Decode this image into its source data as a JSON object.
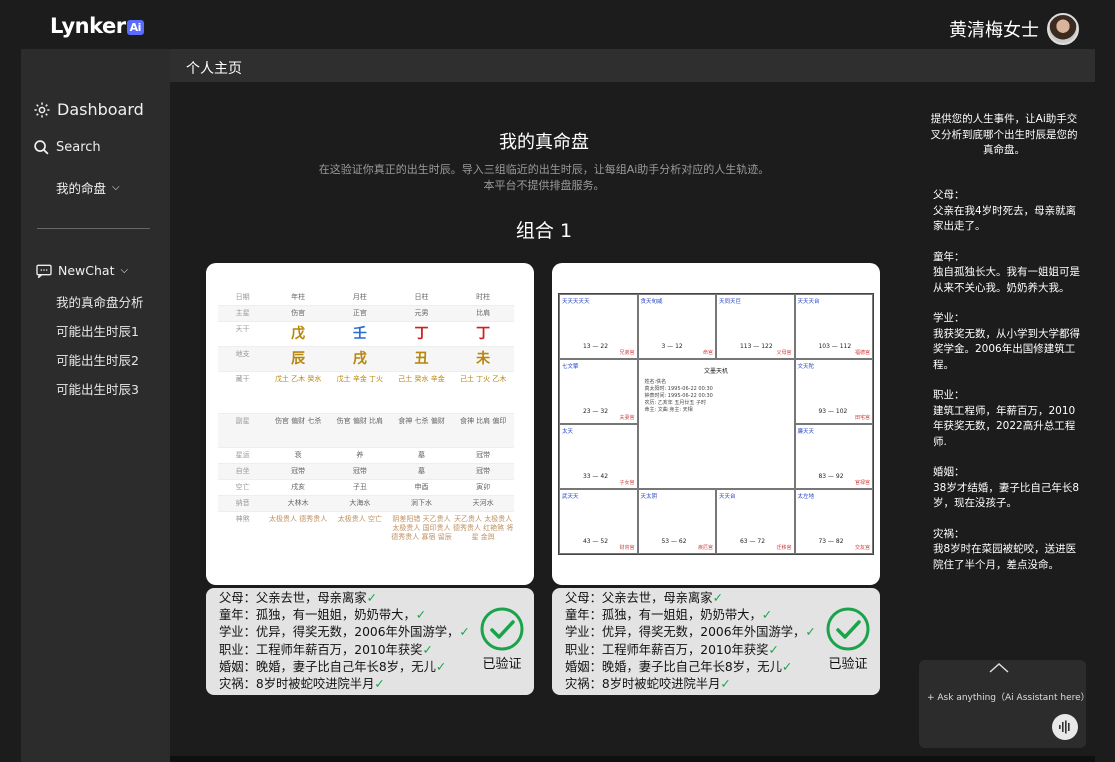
{
  "app": {
    "logo_text": "Lynker",
    "logo_badge": "Ai",
    "user_name": "黄清梅女士"
  },
  "header": {
    "page_label": "个人主页"
  },
  "sidebar": {
    "dashboard": "Dashboard",
    "search": "Search",
    "my_chart": "我的命盘",
    "newchat": "NewChat",
    "items": [
      "我的真命盘分析",
      "可能出生时辰1",
      "可能出生时辰2",
      "可能出生时辰3"
    ]
  },
  "main": {
    "title": "我的真命盘",
    "subtitle_1": "在这验证你真正的出生时辰。导入三组临近的出生时辰，让每组Ai助手分析对应的人生轨迹。",
    "subtitle_2": "本平台不提供排盘服务。",
    "group_title": "组合 1",
    "verified_label": "已验证",
    "info_lines": [
      "父母：父亲去世，母亲离家",
      "童年：孤独，有一姐姐，奶奶带大，",
      "学业：优异，得奖无数，2006年外国游学，",
      "职业：工程师年薪百万，2010年获奖",
      "婚姻：晚婚，妻子比自己年长8岁，无儿",
      "灾祸：8岁时被蛇咬进院半月"
    ]
  },
  "bazi": {
    "headers": [
      "日期",
      "年柱",
      "月柱",
      "日柱",
      "时柱"
    ],
    "zhuxing": [
      "主星",
      "伤官",
      "正官",
      "元男",
      "比肩"
    ],
    "tiangan": [
      "天干",
      "戊",
      "壬",
      "丁",
      "丁"
    ],
    "dizhi": [
      "地支",
      "辰",
      "戌",
      "丑",
      "未"
    ],
    "canggan": [
      "藏干",
      "戊土 乙木 癸水",
      "戊土 辛金 丁火",
      "己土 癸水 辛金",
      "己土 丁火 乙木"
    ],
    "fuxing": [
      "副星",
      "伤官 偏财 七杀",
      "伤官 偏财 比肩",
      "食神 七杀 偏财",
      "食神 比肩 偏印"
    ],
    "xingyun": [
      "星运",
      "衰",
      "养",
      "墓",
      "冠带"
    ],
    "zizuo": [
      "自坐",
      "冠带",
      "冠带",
      "墓",
      "冠带"
    ],
    "kongwang": [
      "空亡",
      "戌亥",
      "子丑",
      "申酉",
      "寅卯"
    ],
    "nayin": [
      "纳音",
      "大林木",
      "大海水",
      "涧下水",
      "天河水"
    ],
    "shensha": [
      "神煞",
      "太极贵人 德秀贵人",
      "太极贵人 空亡",
      "阴差阳错 天乙贵人 太极贵人 国印贵人 德秀贵人 寡宿 留辰",
      "天乙贵人 太极贵人 德秀贵人 红艳煞 将星 金舆"
    ]
  },
  "ziwei": {
    "center_title": "文墨天机",
    "cells": [
      {
        "stars": "天天天天天",
        "num": "13 — 22",
        "tag": "兄弟宫"
      },
      {
        "stars": "贪天旬咸",
        "num": "3 — 12",
        "tag": "命宫"
      },
      {
        "stars": "天同天巨",
        "num": "113 — 122",
        "tag": "父母宫"
      },
      {
        "stars": "天天天台",
        "num": "103 — 112",
        "tag": "福德宫"
      },
      {
        "stars": "七文擎",
        "num": "23 — 32",
        "tag": "夫妻宫"
      },
      {
        "stars": "文天陀",
        "num": "93 — 102",
        "tag": "田宅宫"
      },
      {
        "stars": "太天",
        "num": "33 — 42",
        "tag": "子女宫"
      },
      {
        "stars": "廉天天",
        "num": "83 — 92",
        "tag": "官禄宫"
      },
      {
        "stars": "武天天",
        "num": "43 — 52",
        "tag": "财帛宫"
      },
      {
        "stars": "天太阴",
        "num": "53 — 62",
        "tag": "疾厄宫"
      },
      {
        "stars": "天天台",
        "num": "63 — 72",
        "tag": "迁移宫"
      },
      {
        "stars": "太左地",
        "num": "73 — 82",
        "tag": "交友宫"
      }
    ],
    "center_info": [
      "姓名:佚名",
      "真太阳时: 1995-06-22 00:30",
      "钟表时间: 1995-06-22 00:30",
      "农历: 乙亥年 五月廿五 子时",
      "命主: 文曲 身主: 天相"
    ]
  },
  "right_panel": {
    "intro": "提供您的人生事件，让Ai助手交叉分析到底哪个出生时辰是您的真命盘。",
    "events": [
      {
        "title": "父母：",
        "text": "父亲在我4岁时死去，母亲就离家出走了。"
      },
      {
        "title": "童年：",
        "text": "独自孤独长大。我有一姐姐可是从来不关心我。奶奶养大我。"
      },
      {
        "title": "学业：",
        "text": " 我获奖无数，从小学到大学都得奖学金。2006年出国修建筑工程。"
      },
      {
        "title": "职业：",
        "text": "建筑工程师，年薪百万，2010年获奖无数，2022高升总工程师."
      },
      {
        "title": "婚姻：",
        "text": "38岁才结婚，妻子比自己年长8岁，现在没孩子。"
      },
      {
        "title": "灾祸：",
        "text": "我8岁时在菜园被蛇咬，送进医院住了半个月，差点没命。"
      }
    ],
    "chat_placeholder": "+ Ask anything（Ai Assistant here）"
  },
  "colors": {
    "accent": "#5a6cff",
    "verify_green": "#1aa34a"
  }
}
